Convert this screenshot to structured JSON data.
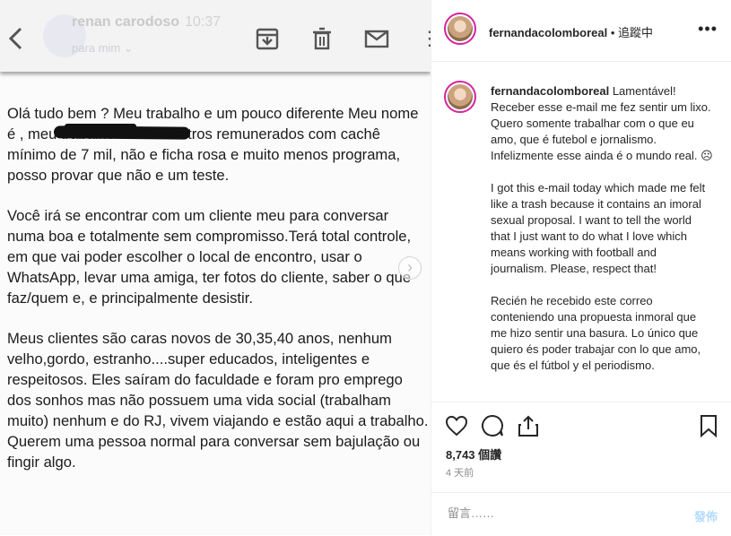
{
  "email": {
    "sender": "renan carodoso",
    "time": "10:37",
    "recipient": "para mim ⌄",
    "paragraphs": [
      "Olá tudo bem ? Meu trabalho e um pouco diferente Meu nome é                          , meu trabalho são encontros remunerados com cachê mínimo de 7 mil, não e ficha rosa e muito menos programa, posso provar que não e um teste.",
      "Você irá se encontrar com um cliente meu para conversar numa boa e totalmente sem compromisso.Terá total controle, em que vai poder escolher o local de encontro, usar o WhatsApp, levar uma amiga, ter fotos do cliente, saber o que faz/quem e, e principalmente desistir.",
      "Meus clientes são caras novos de 30,35,40 anos, nenhum velho,gordo, estranho....super educados, inteligentes e respeitosos. Eles saíram do faculdade e foram pro emprego dos sonhos mas não possuem uma vida social (trabalham muito) nenhum e do RJ, vivem viajando e estão aqui a trabalho. Querem   uma pessoa normal para conversar sem bajulação ou fingir algo."
    ],
    "next_glyph": "›",
    "more_glyph": "⋮"
  },
  "post": {
    "username": "fernandacolomboreal",
    "follow_status": " • 追蹤中",
    "more_glyph": "•••",
    "caption_user": "fernandacolomboreal",
    "caption_paragraphs": [
      "Lamentável! Receber esse e-mail me fez sentir um lixo. Quero somente trabalhar com o que eu amo, que é futebol e jornalismo. Infelizmente esse ainda é o mundo real. ☹",
      "I got this e-mail today which made me felt like a trash because it contains an imoral sexual proposal. I want to tell the world that I just want to do what I love which means working with football and journalism. Please, respect that!",
      "Recién he recebido este correo conteniendo una propuesta inmoral que me hizo sentir una basura. Lo único que quiero és poder trabajar con lo que amo, que és el fútbol y el periodismo."
    ],
    "views": "8,743 個讚",
    "ago": "4 天前",
    "comment_placeholder": "留言……",
    "post_button": "發佈"
  },
  "icons": [
    "back-icon",
    "archive-icon",
    "trash-icon",
    "mail-icon",
    "more-icon",
    "heart-icon",
    "comment-icon",
    "share-icon",
    "bookmark-icon"
  ],
  "colors": {
    "post_button": "#b3dbff",
    "avatar_ring": "#d6249f",
    "text": "#262626",
    "muted": "#8e8e8e"
  }
}
